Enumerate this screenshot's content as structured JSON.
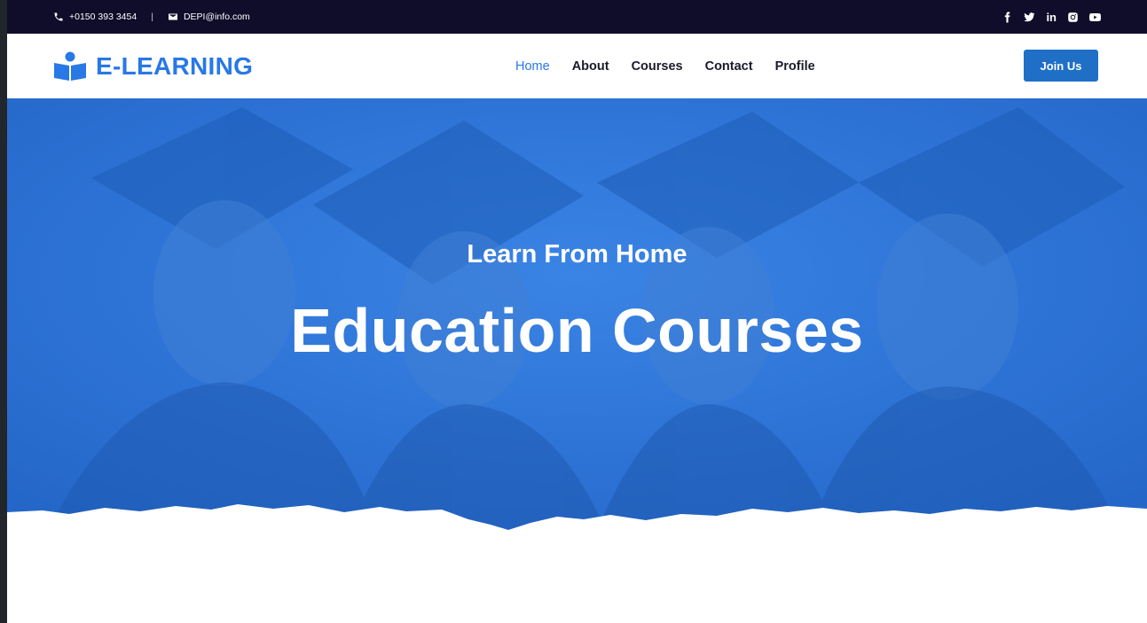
{
  "topbar": {
    "phone": "+0150 393 3454",
    "separator": "|",
    "email": "DEPI@info.com",
    "social": {
      "facebook_icon": "facebook-icon",
      "twitter_icon": "twitter-icon",
      "linkedin_label": "in",
      "instagram_icon": "instagram-icon",
      "youtube_icon": "youtube-icon"
    }
  },
  "brand": {
    "name": "E-LEARNING",
    "logo_icon": "reader-book-icon",
    "color": "#2878e6"
  },
  "nav": {
    "items": [
      {
        "label": "Home",
        "active": true
      },
      {
        "label": "About",
        "active": false
      },
      {
        "label": "Courses",
        "active": false
      },
      {
        "label": "Contact",
        "active": false
      },
      {
        "label": "Profile",
        "active": false
      }
    ],
    "join_label": "Join Us"
  },
  "hero": {
    "subtitle": "Learn From Home",
    "title": "Education Courses",
    "overlay_color": "#2c76dc"
  }
}
